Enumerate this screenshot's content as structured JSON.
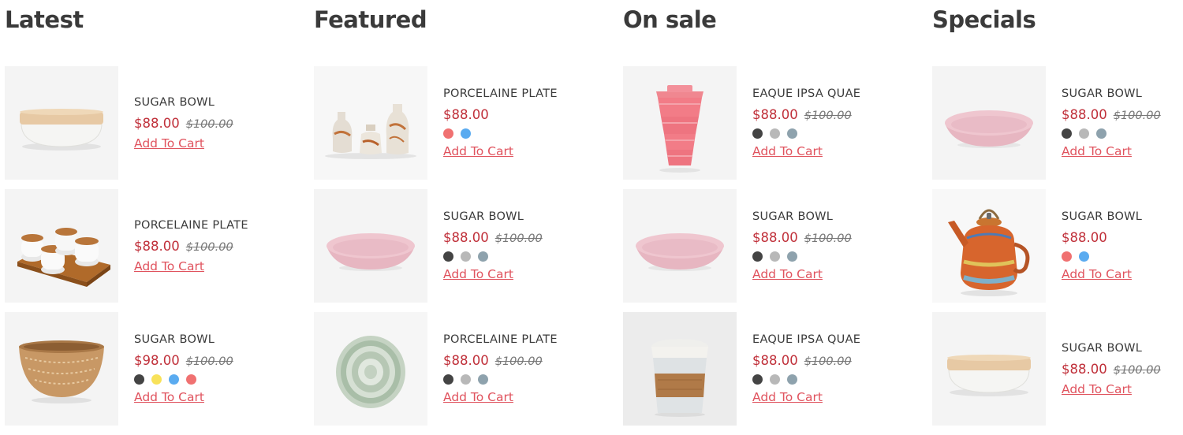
{
  "columns": [
    {
      "title": "Latest",
      "items": [
        {
          "name": "SUGAR BOWL",
          "price": "$88.00",
          "old_price": "$100.00",
          "swatches": [],
          "cart": "Add To Cart",
          "image": "lidded-bowl-image"
        },
        {
          "name": "PORCELAINE PLATE",
          "price": "$88.00",
          "old_price": "$100.00",
          "swatches": [],
          "cart": "Add To Cart",
          "image": "sugar-pots-tray-image"
        },
        {
          "name": "SUGAR BOWL",
          "price": "$98.00",
          "old_price": "$100.00",
          "swatches": [
            "#444444",
            "#f8e25a",
            "#5aabf0",
            "#f07171"
          ],
          "cart": "Add To Cart",
          "image": "patterned-bowl-image"
        }
      ]
    },
    {
      "title": "Featured",
      "items": [
        {
          "name": "PORCELAINE PLATE",
          "price": "$88.00",
          "old_price": "",
          "swatches": [
            "#f07171",
            "#5aabf0"
          ],
          "cart": "Add To Cart",
          "image": "ceramic-jars-image"
        },
        {
          "name": "SUGAR BOWL",
          "price": "$88.00",
          "old_price": "$100.00",
          "swatches": [
            "#444444",
            "#b8b8b8",
            "#8ea2ad"
          ],
          "cart": "Add To Cart",
          "image": "pink-bowl-image"
        },
        {
          "name": "PORCELAINE PLATE",
          "price": "$88.00",
          "old_price": "$100.00",
          "swatches": [
            "#444444",
            "#b8b8b8",
            "#8ea2ad"
          ],
          "cart": "Add To Cart",
          "image": "green-plates-image"
        }
      ]
    },
    {
      "title": "On sale",
      "items": [
        {
          "name": "EAQUE IPSA QUAE",
          "price": "$88.00",
          "old_price": "$100.00",
          "swatches": [
            "#444444",
            "#b8b8b8",
            "#8ea2ad"
          ],
          "cart": "Add To Cart",
          "image": "pink-cup-image"
        },
        {
          "name": "SUGAR BOWL",
          "price": "$88.00",
          "old_price": "$100.00",
          "swatches": [
            "#444444",
            "#b8b8b8",
            "#8ea2ad"
          ],
          "cart": "Add To Cart",
          "image": "pink-bowl-image"
        },
        {
          "name": "EAQUE IPSA QUAE",
          "price": "$88.00",
          "old_price": "$100.00",
          "swatches": [
            "#444444",
            "#b8b8b8",
            "#8ea2ad"
          ],
          "cart": "Add To Cart",
          "image": "glass-cup-image"
        }
      ]
    },
    {
      "title": "Specials",
      "items": [
        {
          "name": "SUGAR BOWL",
          "price": "$88.00",
          "old_price": "$100.00",
          "swatches": [
            "#444444",
            "#b8b8b8",
            "#8ea2ad"
          ],
          "cart": "Add To Cart",
          "image": "pink-bowl-image"
        },
        {
          "name": "SUGAR BOWL",
          "price": "$88.00",
          "old_price": "",
          "swatches": [
            "#f07171",
            "#5aabf0"
          ],
          "cart": "Add To Cart",
          "image": "teapot-image"
        },
        {
          "name": "SUGAR BOWL",
          "price": "$88.00",
          "old_price": "$100.00",
          "swatches": [],
          "cart": "Add To Cart",
          "image": "lidded-bowl-image"
        }
      ]
    }
  ],
  "colors": {
    "price": "#c0303a",
    "cart_link": "#e0535e",
    "thumb_bg": "#f4f4f4"
  }
}
